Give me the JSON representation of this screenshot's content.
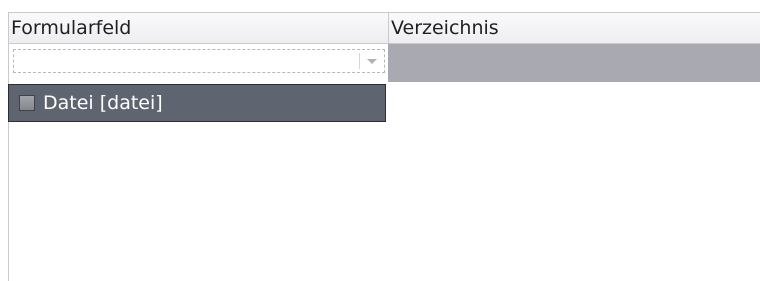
{
  "table": {
    "columns": [
      "Formularfeld",
      "Verzeichnis"
    ],
    "filter": {
      "value": "",
      "icon": "chevron-down-icon"
    },
    "rows": [
      {
        "label": "Datei [datei]",
        "icon": "checkbox-icon",
        "selected": true
      }
    ]
  }
}
